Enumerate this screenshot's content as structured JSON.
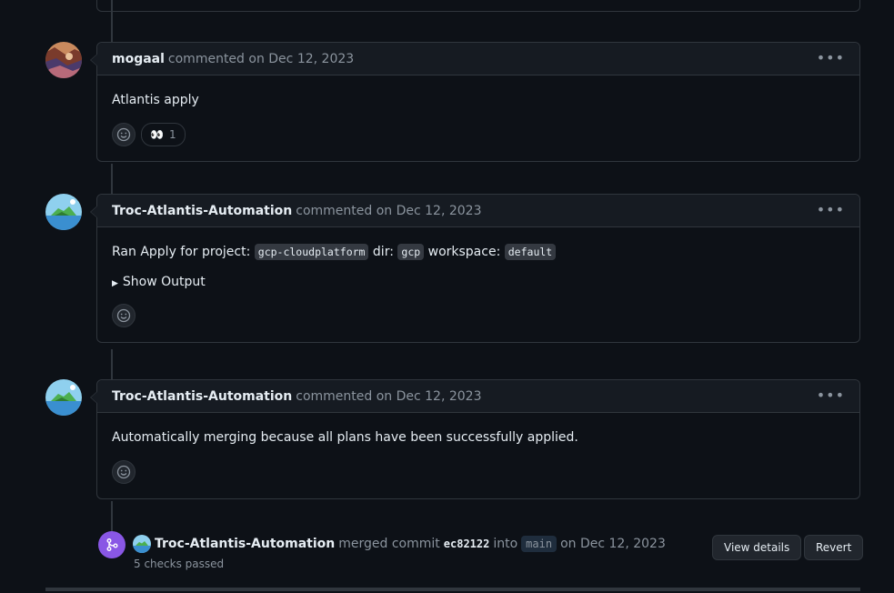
{
  "comments": [
    {
      "author": "mogaal",
      "meta": "commented on Dec 12, 2023",
      "body": "Atlantis apply",
      "reaction": {
        "emoji": "👀",
        "count": "1"
      }
    },
    {
      "author": "Troc-Atlantis-Automation",
      "meta": "commented on Dec 12, 2023",
      "body_parts": {
        "t1": "Ran Apply for project:",
        "c1": "gcp-cloudplatform",
        "t2": "dir:",
        "c2": "gcp",
        "t3": "workspace:",
        "c3": "default"
      },
      "details_label": "Show Output"
    },
    {
      "author": "Troc-Atlantis-Automation",
      "meta": "commented on Dec 12, 2023",
      "body": "Automatically merging because all plans have been successfully applied."
    }
  ],
  "merge_event": {
    "author": "Troc-Atlantis-Automation",
    "action": "merged commit",
    "commit": "ec82122",
    "into": "into",
    "branch": "main",
    "date": "on Dec 12, 2023",
    "checks": "5 checks passed",
    "view_details_label": "View details",
    "revert_label": "Revert"
  },
  "icons": {
    "more": "kebab-horizontal-icon",
    "smiley": "smiley-icon",
    "merge": "git-merge-icon"
  },
  "colors": {
    "background": "#0d1117",
    "header": "#161b22",
    "border": "#30363d",
    "merge_accent": "#8957e5",
    "muted": "#8b949e"
  }
}
